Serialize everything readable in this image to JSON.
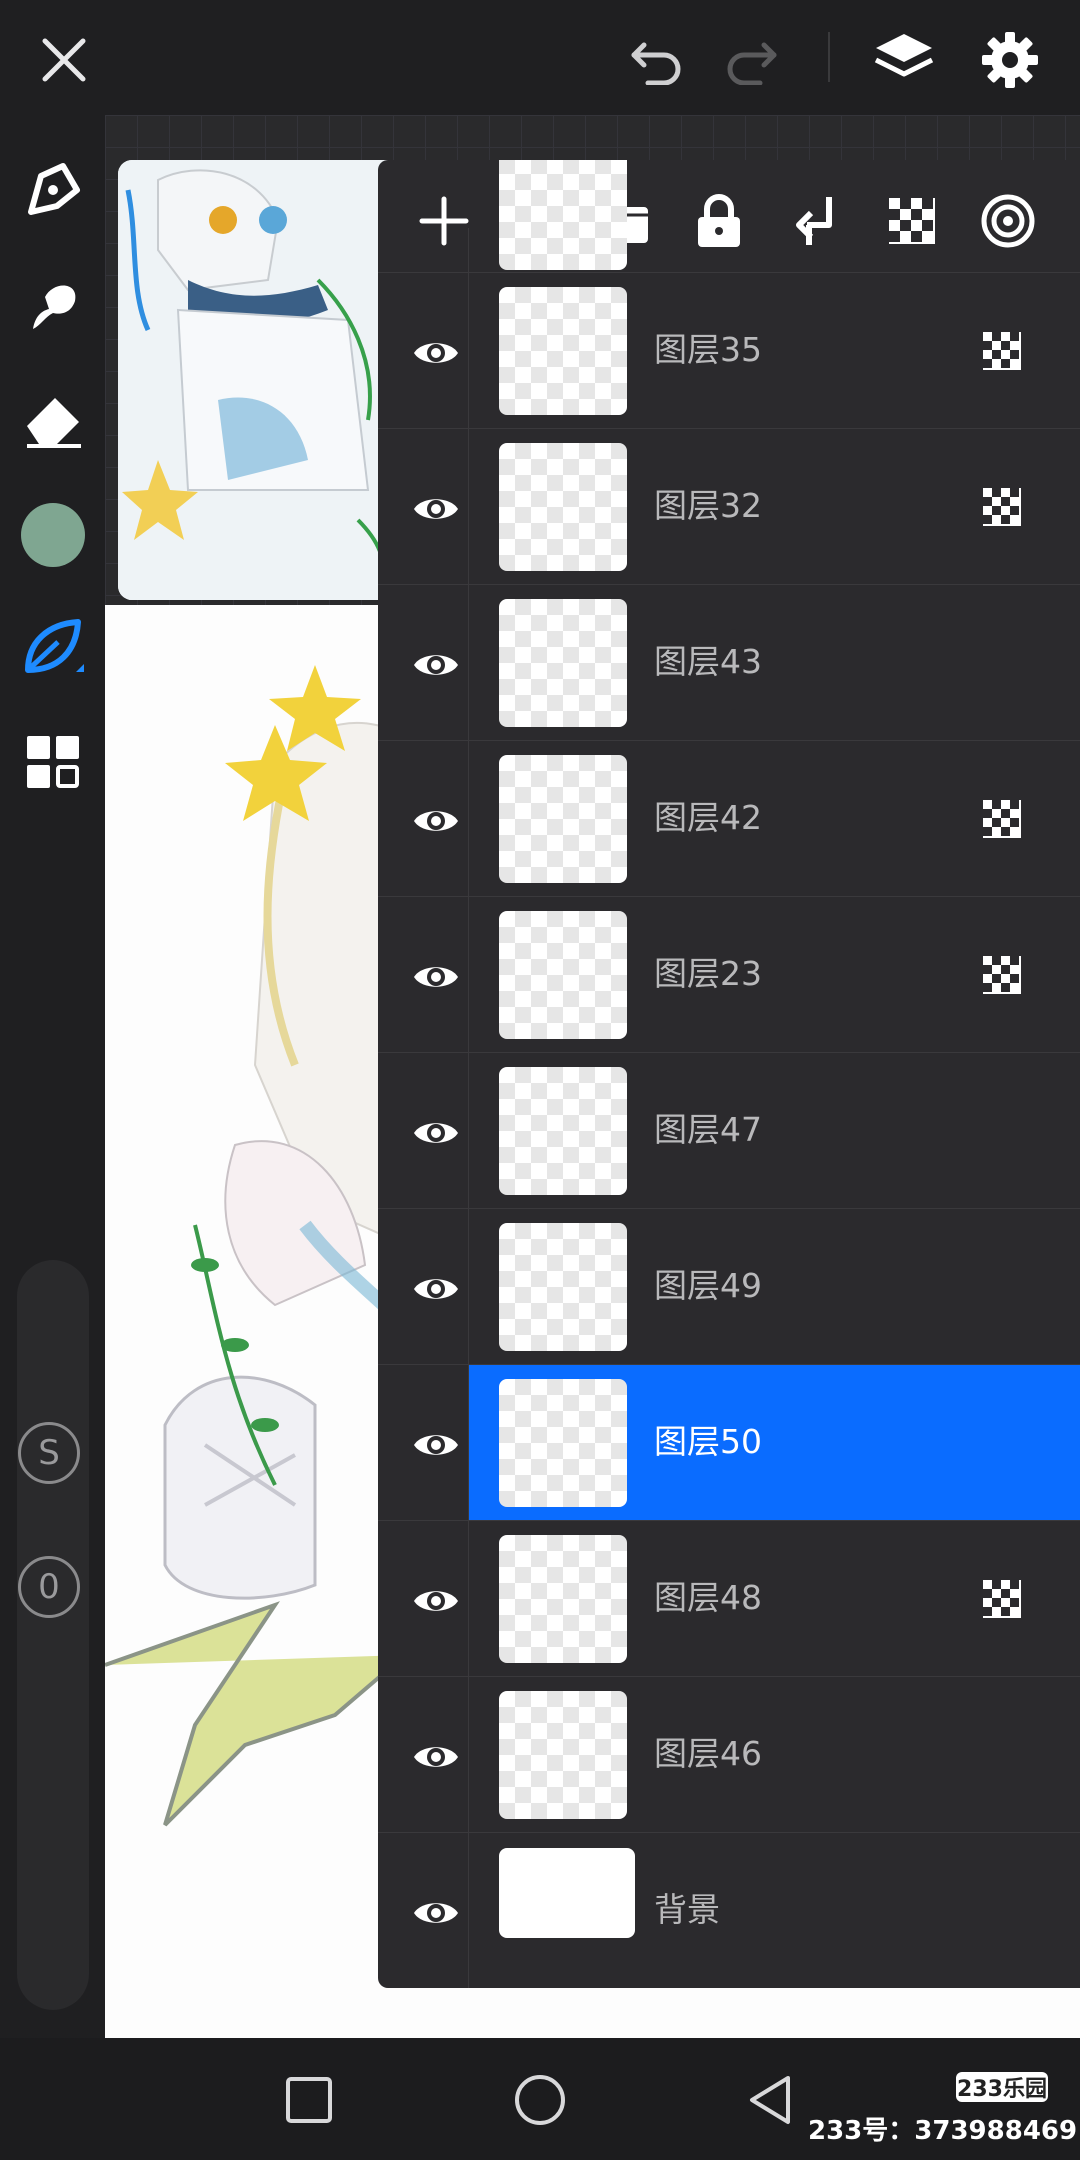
{
  "topbar": {
    "close": "close-icon",
    "undo": "undo-icon",
    "redo": "redo-icon",
    "layers": "layers-icon",
    "settings": "gear-icon"
  },
  "toolbar": {
    "tools": [
      "pen-icon",
      "smudge-icon",
      "eraser-icon",
      "color-swatch",
      "leaf-brush-icon",
      "grid-menu-icon"
    ],
    "active_color": "#7fa691",
    "s_button": "S",
    "zero_button": "0"
  },
  "panel": {
    "tools": [
      "add-layer-icon",
      "folder-icon",
      "lock-icon",
      "merge-down-icon",
      "checker-icon",
      "target-icon"
    ],
    "layers": [
      {
        "name": "图层35",
        "visible": true,
        "alpha_lock": true,
        "selected": false
      },
      {
        "name": "图层32",
        "visible": true,
        "alpha_lock": true,
        "selected": false
      },
      {
        "name": "图层43",
        "visible": true,
        "alpha_lock": false,
        "selected": false
      },
      {
        "name": "图层42",
        "visible": true,
        "alpha_lock": true,
        "selected": false
      },
      {
        "name": "图层23",
        "visible": true,
        "alpha_lock": true,
        "selected": false
      },
      {
        "name": "图层47",
        "visible": true,
        "alpha_lock": false,
        "selected": false
      },
      {
        "name": "图层49",
        "visible": true,
        "alpha_lock": false,
        "selected": false
      },
      {
        "name": "图层50",
        "visible": true,
        "alpha_lock": false,
        "selected": true
      },
      {
        "name": "图层48",
        "visible": true,
        "alpha_lock": true,
        "selected": false
      },
      {
        "name": "图层46",
        "visible": true,
        "alpha_lock": false,
        "selected": false
      },
      {
        "name": "背景",
        "visible": true,
        "alpha_lock": false,
        "selected": false
      }
    ],
    "accent": "#0a6cff"
  },
  "navbar": {
    "square": "recent-apps-icon",
    "circle": "home-icon",
    "back": "back-icon"
  },
  "watermark": {
    "badge": "233乐园",
    "text": "233号：373988469"
  }
}
